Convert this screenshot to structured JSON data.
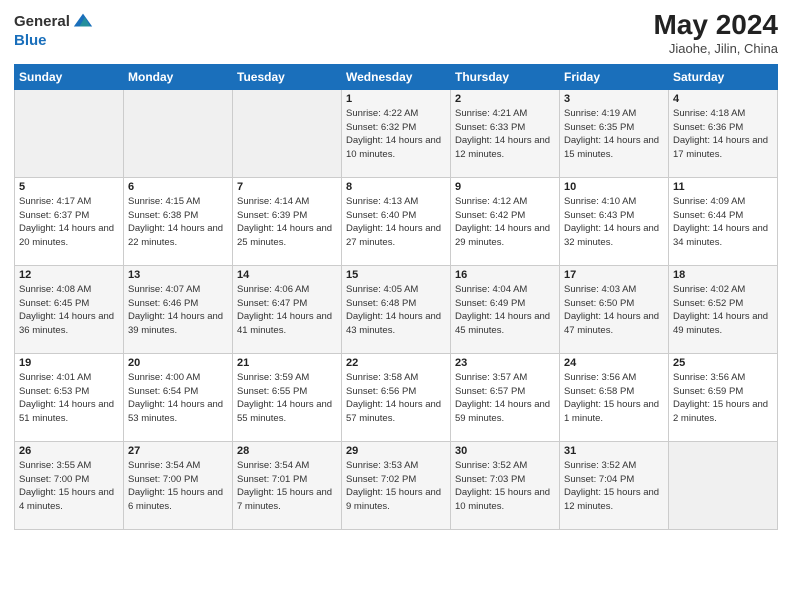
{
  "header": {
    "logo_general": "General",
    "logo_blue": "Blue",
    "month_year": "May 2024",
    "location": "Jiaohe, Jilin, China"
  },
  "weekdays": [
    "Sunday",
    "Monday",
    "Tuesday",
    "Wednesday",
    "Thursday",
    "Friday",
    "Saturday"
  ],
  "weeks": [
    [
      {
        "day": "",
        "sunrise": "",
        "sunset": "",
        "daylight": "",
        "empty": true
      },
      {
        "day": "",
        "sunrise": "",
        "sunset": "",
        "daylight": "",
        "empty": true
      },
      {
        "day": "",
        "sunrise": "",
        "sunset": "",
        "daylight": "",
        "empty": true
      },
      {
        "day": "1",
        "sunrise": "Sunrise: 4:22 AM",
        "sunset": "Sunset: 6:32 PM",
        "daylight": "Daylight: 14 hours and 10 minutes.",
        "empty": false
      },
      {
        "day": "2",
        "sunrise": "Sunrise: 4:21 AM",
        "sunset": "Sunset: 6:33 PM",
        "daylight": "Daylight: 14 hours and 12 minutes.",
        "empty": false
      },
      {
        "day": "3",
        "sunrise": "Sunrise: 4:19 AM",
        "sunset": "Sunset: 6:35 PM",
        "daylight": "Daylight: 14 hours and 15 minutes.",
        "empty": false
      },
      {
        "day": "4",
        "sunrise": "Sunrise: 4:18 AM",
        "sunset": "Sunset: 6:36 PM",
        "daylight": "Daylight: 14 hours and 17 minutes.",
        "empty": false
      }
    ],
    [
      {
        "day": "5",
        "sunrise": "Sunrise: 4:17 AM",
        "sunset": "Sunset: 6:37 PM",
        "daylight": "Daylight: 14 hours and 20 minutes.",
        "empty": false
      },
      {
        "day": "6",
        "sunrise": "Sunrise: 4:15 AM",
        "sunset": "Sunset: 6:38 PM",
        "daylight": "Daylight: 14 hours and 22 minutes.",
        "empty": false
      },
      {
        "day": "7",
        "sunrise": "Sunrise: 4:14 AM",
        "sunset": "Sunset: 6:39 PM",
        "daylight": "Daylight: 14 hours and 25 minutes.",
        "empty": false
      },
      {
        "day": "8",
        "sunrise": "Sunrise: 4:13 AM",
        "sunset": "Sunset: 6:40 PM",
        "daylight": "Daylight: 14 hours and 27 minutes.",
        "empty": false
      },
      {
        "day": "9",
        "sunrise": "Sunrise: 4:12 AM",
        "sunset": "Sunset: 6:42 PM",
        "daylight": "Daylight: 14 hours and 29 minutes.",
        "empty": false
      },
      {
        "day": "10",
        "sunrise": "Sunrise: 4:10 AM",
        "sunset": "Sunset: 6:43 PM",
        "daylight": "Daylight: 14 hours and 32 minutes.",
        "empty": false
      },
      {
        "day": "11",
        "sunrise": "Sunrise: 4:09 AM",
        "sunset": "Sunset: 6:44 PM",
        "daylight": "Daylight: 14 hours and 34 minutes.",
        "empty": false
      }
    ],
    [
      {
        "day": "12",
        "sunrise": "Sunrise: 4:08 AM",
        "sunset": "Sunset: 6:45 PM",
        "daylight": "Daylight: 14 hours and 36 minutes.",
        "empty": false
      },
      {
        "day": "13",
        "sunrise": "Sunrise: 4:07 AM",
        "sunset": "Sunset: 6:46 PM",
        "daylight": "Daylight: 14 hours and 39 minutes.",
        "empty": false
      },
      {
        "day": "14",
        "sunrise": "Sunrise: 4:06 AM",
        "sunset": "Sunset: 6:47 PM",
        "daylight": "Daylight: 14 hours and 41 minutes.",
        "empty": false
      },
      {
        "day": "15",
        "sunrise": "Sunrise: 4:05 AM",
        "sunset": "Sunset: 6:48 PM",
        "daylight": "Daylight: 14 hours and 43 minutes.",
        "empty": false
      },
      {
        "day": "16",
        "sunrise": "Sunrise: 4:04 AM",
        "sunset": "Sunset: 6:49 PM",
        "daylight": "Daylight: 14 hours and 45 minutes.",
        "empty": false
      },
      {
        "day": "17",
        "sunrise": "Sunrise: 4:03 AM",
        "sunset": "Sunset: 6:50 PM",
        "daylight": "Daylight: 14 hours and 47 minutes.",
        "empty": false
      },
      {
        "day": "18",
        "sunrise": "Sunrise: 4:02 AM",
        "sunset": "Sunset: 6:52 PM",
        "daylight": "Daylight: 14 hours and 49 minutes.",
        "empty": false
      }
    ],
    [
      {
        "day": "19",
        "sunrise": "Sunrise: 4:01 AM",
        "sunset": "Sunset: 6:53 PM",
        "daylight": "Daylight: 14 hours and 51 minutes.",
        "empty": false
      },
      {
        "day": "20",
        "sunrise": "Sunrise: 4:00 AM",
        "sunset": "Sunset: 6:54 PM",
        "daylight": "Daylight: 14 hours and 53 minutes.",
        "empty": false
      },
      {
        "day": "21",
        "sunrise": "Sunrise: 3:59 AM",
        "sunset": "Sunset: 6:55 PM",
        "daylight": "Daylight: 14 hours and 55 minutes.",
        "empty": false
      },
      {
        "day": "22",
        "sunrise": "Sunrise: 3:58 AM",
        "sunset": "Sunset: 6:56 PM",
        "daylight": "Daylight: 14 hours and 57 minutes.",
        "empty": false
      },
      {
        "day": "23",
        "sunrise": "Sunrise: 3:57 AM",
        "sunset": "Sunset: 6:57 PM",
        "daylight": "Daylight: 14 hours and 59 minutes.",
        "empty": false
      },
      {
        "day": "24",
        "sunrise": "Sunrise: 3:56 AM",
        "sunset": "Sunset: 6:58 PM",
        "daylight": "Daylight: 15 hours and 1 minute.",
        "empty": false
      },
      {
        "day": "25",
        "sunrise": "Sunrise: 3:56 AM",
        "sunset": "Sunset: 6:59 PM",
        "daylight": "Daylight: 15 hours and 2 minutes.",
        "empty": false
      }
    ],
    [
      {
        "day": "26",
        "sunrise": "Sunrise: 3:55 AM",
        "sunset": "Sunset: 7:00 PM",
        "daylight": "Daylight: 15 hours and 4 minutes.",
        "empty": false
      },
      {
        "day": "27",
        "sunrise": "Sunrise: 3:54 AM",
        "sunset": "Sunset: 7:00 PM",
        "daylight": "Daylight: 15 hours and 6 minutes.",
        "empty": false
      },
      {
        "day": "28",
        "sunrise": "Sunrise: 3:54 AM",
        "sunset": "Sunset: 7:01 PM",
        "daylight": "Daylight: 15 hours and 7 minutes.",
        "empty": false
      },
      {
        "day": "29",
        "sunrise": "Sunrise: 3:53 AM",
        "sunset": "Sunset: 7:02 PM",
        "daylight": "Daylight: 15 hours and 9 minutes.",
        "empty": false
      },
      {
        "day": "30",
        "sunrise": "Sunrise: 3:52 AM",
        "sunset": "Sunset: 7:03 PM",
        "daylight": "Daylight: 15 hours and 10 minutes.",
        "empty": false
      },
      {
        "day": "31",
        "sunrise": "Sunrise: 3:52 AM",
        "sunset": "Sunset: 7:04 PM",
        "daylight": "Daylight: 15 hours and 12 minutes.",
        "empty": false
      },
      {
        "day": "",
        "sunrise": "",
        "sunset": "",
        "daylight": "",
        "empty": true
      }
    ]
  ]
}
